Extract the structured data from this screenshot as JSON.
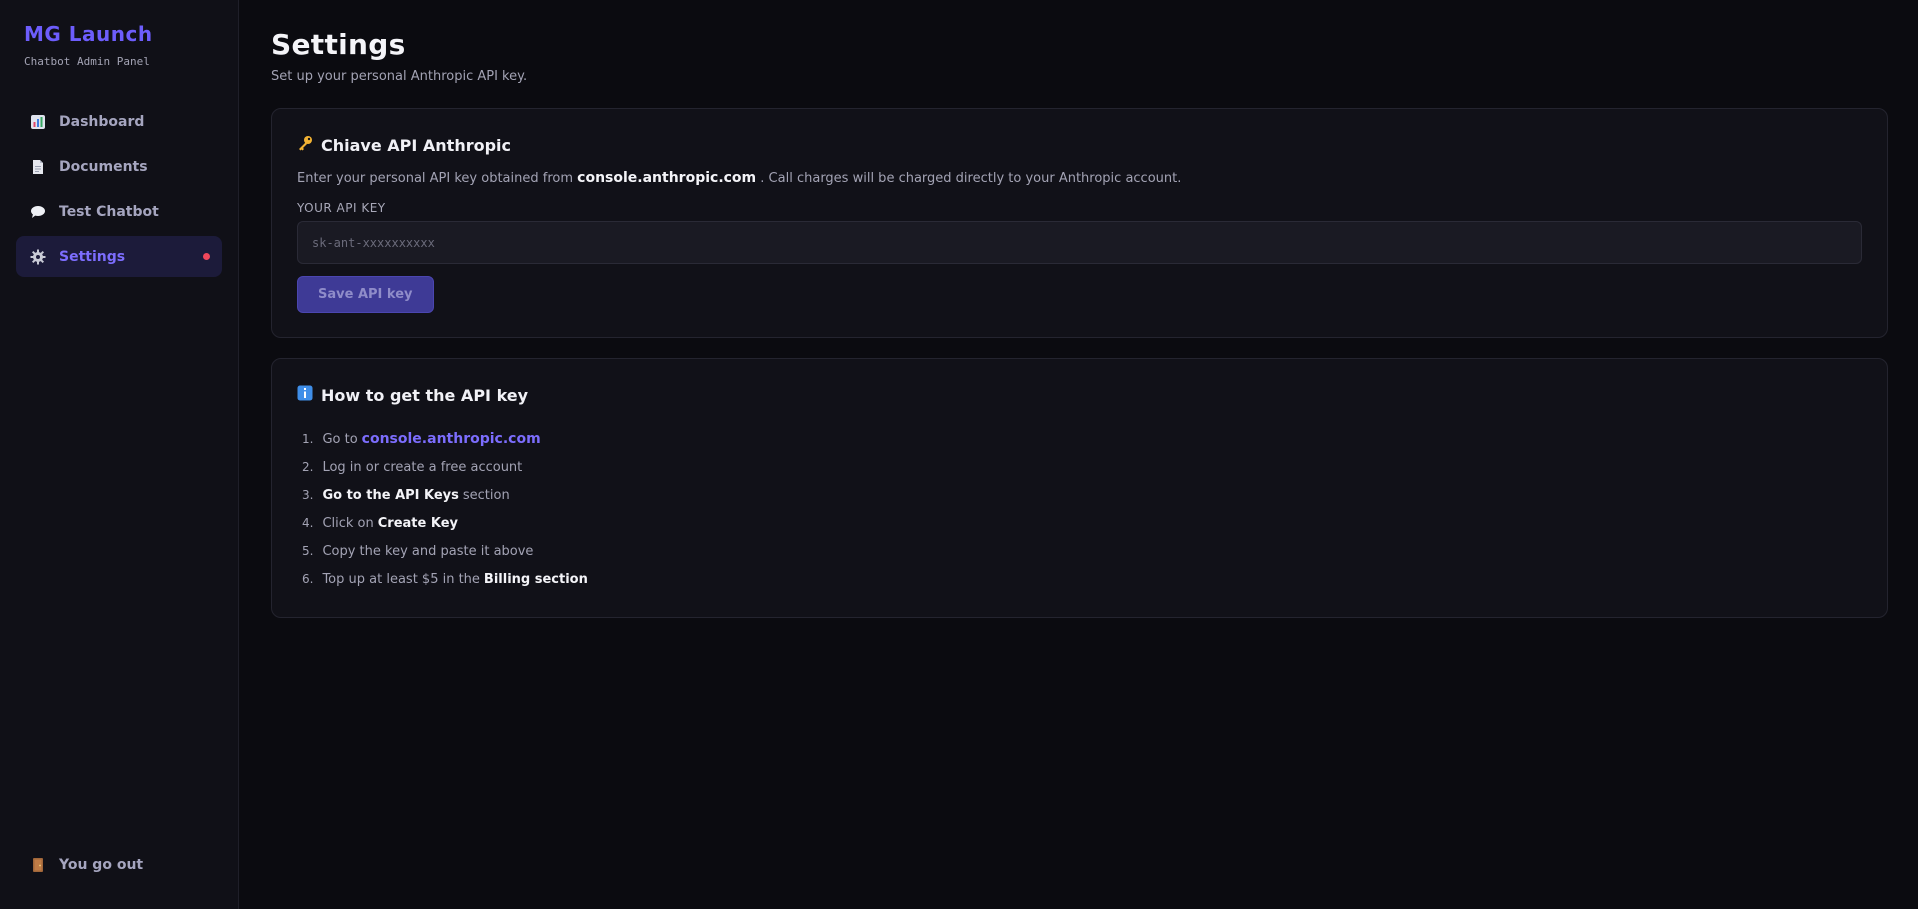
{
  "brand": {
    "title": "MG Launch",
    "subtitle": "Chatbot Admin Panel"
  },
  "sidebar": {
    "items": [
      {
        "label": "Dashboard",
        "icon": "bar-chart-icon"
      },
      {
        "label": "Documents",
        "icon": "document-icon"
      },
      {
        "label": "Test Chatbot",
        "icon": "speech-bubble-icon"
      },
      {
        "label": "Settings",
        "icon": "gear-icon",
        "active": true
      }
    ],
    "logout": {
      "label": "You go out",
      "icon": "door-icon"
    }
  },
  "page": {
    "title": "Settings",
    "subtitle": "Set up your personal Anthropic API key."
  },
  "api_card": {
    "title": "Chiave API Anthropic",
    "icon": "key-icon",
    "desc_before": "Enter your personal API key obtained from",
    "desc_link": "console.anthropic.com",
    "desc_after": ". Call charges will be charged directly to your Anthropic account.",
    "field_label": "YOUR API KEY",
    "placeholder": "sk-ant-xxxxxxxxxx",
    "value": "",
    "save_label": "Save API key"
  },
  "howto_card": {
    "title": "How to get the API key",
    "icon": "info-icon",
    "steps": [
      {
        "num": "1.",
        "before": "Go to",
        "link": "console.anthropic.com"
      },
      {
        "num": "2.",
        "before": "Log in or create a free account"
      },
      {
        "num": "3.",
        "bold": "Go to the API Keys",
        "after": "section"
      },
      {
        "num": "4.",
        "before": "Click on",
        "bold": "Create Key"
      },
      {
        "num": "5.",
        "before": "Copy the key and paste it above"
      },
      {
        "num": "6.",
        "before": "Top up at least $5 in the",
        "bold": "Billing section"
      }
    ]
  },
  "colors": {
    "accent": "#6d5dfc",
    "background": "#0b0b10",
    "sidebar": "#101017",
    "card": "#111118",
    "notification_dot": "#f0475b"
  }
}
